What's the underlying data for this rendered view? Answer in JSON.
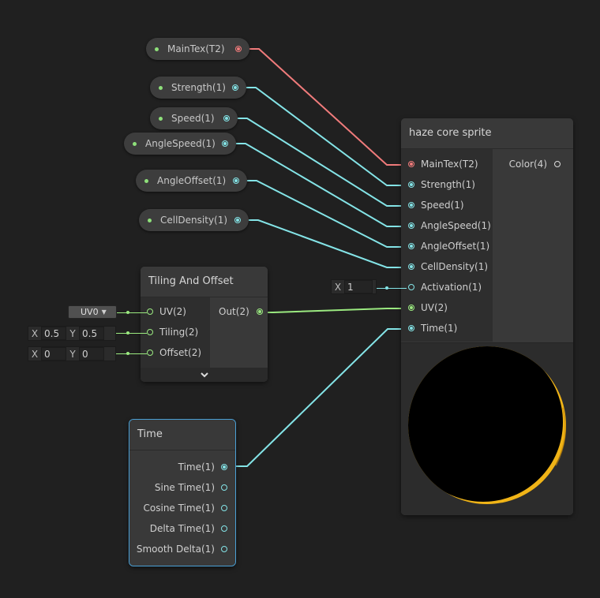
{
  "properties": [
    {
      "label": "MainTex(T2)",
      "type": "texture"
    },
    {
      "label": "Strength(1)",
      "type": "float"
    },
    {
      "label": "Speed(1)",
      "type": "float"
    },
    {
      "label": "AngleSpeed(1)",
      "type": "float"
    },
    {
      "label": "AngleOffset(1)",
      "type": "float"
    },
    {
      "label": "CellDensity(1)",
      "type": "float"
    }
  ],
  "haze_node": {
    "title": "haze core sprite",
    "inputs": [
      "MainTex(T2)",
      "Strength(1)",
      "Speed(1)",
      "AngleSpeed(1)",
      "AngleOffset(1)",
      "CellDensity(1)",
      "Activation(1)",
      "UV(2)",
      "Time(1)"
    ],
    "output": "Color(4)",
    "activation_field": {
      "axis": "X",
      "value": "1"
    }
  },
  "tiling_node": {
    "title": "Tiling And Offset",
    "inputs": [
      "UV(2)",
      "Tiling(2)",
      "Offset(2)"
    ],
    "output": "Out(2)",
    "uv_dropdown": "UV0",
    "tiling": {
      "x_label": "X",
      "x": "0.5",
      "y_label": "Y",
      "y": "0.5"
    },
    "offset": {
      "x_label": "X",
      "x": "0",
      "y_label": "Y",
      "y": "0"
    },
    "collapse_icon": "chevron-down-icon"
  },
  "time_node": {
    "title": "Time",
    "outputs": [
      "Time(1)",
      "Sine Time(1)",
      "Cosine Time(1)",
      "Delta Time(1)",
      "Smooth Delta(1)"
    ]
  },
  "colors": {
    "background": "#202020",
    "texture_wire": "#f07b7b",
    "float_wire": "#84e4e7",
    "vector2_wire": "#9bea80",
    "time_node_highlight": "#4aa0d6",
    "preview_glow": "#f0b417"
  }
}
